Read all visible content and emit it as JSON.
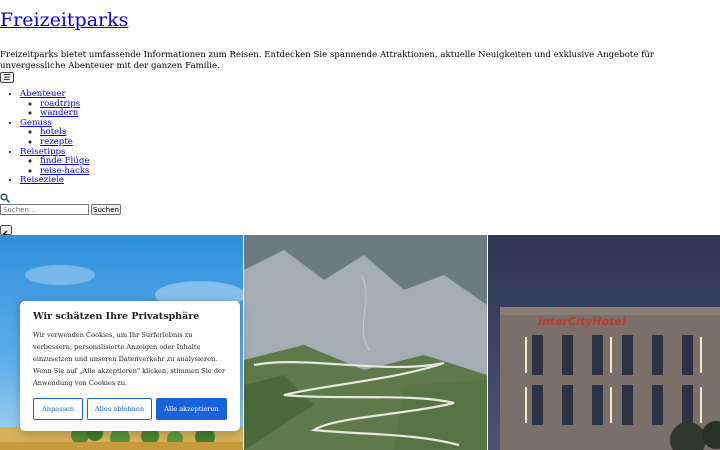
{
  "site": {
    "title": "Freizeitparks",
    "description": "Freizeitparks bietet umfassende Informationen zum Reisen. Entdecken Sie spannende Attraktionen, aktuelle Neuigkeiten und exklusive Angebote für unvergessliche Abenteuer mit der ganzen Familie."
  },
  "menu_toggle": {
    "icon": "hamburger-icon",
    "glyph": "☰"
  },
  "nav": {
    "items": [
      {
        "label": "Abenteuer",
        "children": [
          "roadtrips",
          "wandern"
        ]
      },
      {
        "label": "Genuss",
        "children": [
          "hotels",
          "rezepte"
        ]
      },
      {
        "label": "Reisetipps",
        "children": [
          "finde Flüge",
          "reise-hacks"
        ]
      },
      {
        "label": "Reiseziele",
        "children": []
      }
    ]
  },
  "search": {
    "icon": "search-icon",
    "placeholder": "Suchen …",
    "button_label": "Suchen"
  },
  "slider": {
    "prev_icon": "chevron-left-icon",
    "slides": [
      "wheat-field-image",
      "mountain-pass-road-image",
      "intercity-hotel-image"
    ],
    "hotel_sign": "InterCityHotel"
  },
  "consent": {
    "title": "Wir schätzen Ihre Privatsphäre",
    "text": "Wir verwenden Cookies, um Ihr Surferlebnis zu verbessern, personalisierte Anzeigen oder Inhalte einzusetzen und unseren Datenverkehr zu analysieren. Wenn Sie auf „Alle akzeptieren\" klicken, stimmen Sie der Anwendung von Cookies zu.",
    "buttons": {
      "customize": "Anpassen",
      "reject": "Alles ablehnen",
      "accept": "Alle akzeptieren"
    },
    "accent_color": "#1863dc"
  }
}
